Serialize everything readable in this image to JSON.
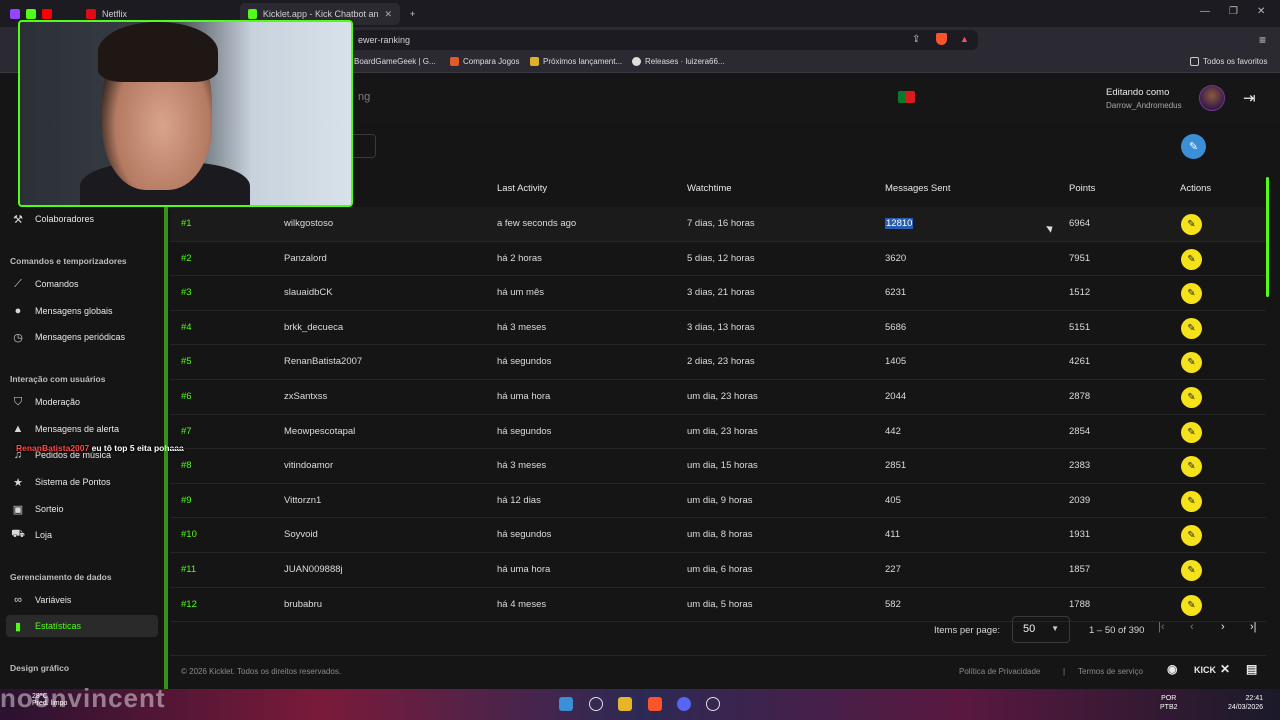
{
  "browser": {
    "tabs": [
      {
        "label": "Netflix"
      },
      {
        "label": "Kicklet.app - Kick Chatbot and C"
      }
    ],
    "new_tab": "+",
    "url": "ewer-ranking",
    "bookmarks": [
      {
        "label": "BoardGameGeek | G..."
      },
      {
        "label": "Compara Jogos"
      },
      {
        "label": "Próximos lançament..."
      },
      {
        "label": "Releases · luizera66..."
      },
      {
        "label": "Todos os favoritos"
      }
    ]
  },
  "header": {
    "page_title": "ng",
    "editing_label": "Editando como",
    "editing_user": "Darrow_Andromedus"
  },
  "sidebar": {
    "items_top": [
      {
        "label": "Colaboradores",
        "icon": "wrench-icon"
      }
    ],
    "sections": [
      {
        "heading": "Comandos e temporizadores",
        "items": [
          {
            "label": "Comandos",
            "icon": "wand-icon"
          },
          {
            "label": "Mensagens globais",
            "icon": "chat-icon"
          },
          {
            "label": "Mensagens periódicas",
            "icon": "clock-icon"
          }
        ]
      },
      {
        "heading": "Interação com usuários",
        "items": [
          {
            "label": "Moderação",
            "icon": "shield-icon"
          },
          {
            "label": "Mensagens de alerta",
            "icon": "alert-icon"
          },
          {
            "label": "Pedidos de música",
            "icon": "music-icon"
          },
          {
            "label": "Sistema de Pontos",
            "icon": "star-icon"
          },
          {
            "label": "Sorteio",
            "icon": "gift-icon"
          },
          {
            "label": "Loja",
            "icon": "cart-icon"
          }
        ]
      },
      {
        "heading": "Gerenciamento de dados",
        "items": [
          {
            "label": "Variáveis",
            "icon": "link-icon"
          },
          {
            "label": "Estatísticas",
            "icon": "bar-chart-icon",
            "active": true
          }
        ]
      },
      {
        "heading": "Design gráfico",
        "items": []
      }
    ]
  },
  "chat_overlay": {
    "user": "RenanBatista2007",
    "message": "eu tô top 5 eita pohaaa"
  },
  "table": {
    "headers": [
      "Last Activity",
      "Watchtime",
      "Messages Sent",
      "Points",
      "Actions"
    ],
    "rows": [
      {
        "rank": "#1",
        "user": "wilkgostoso",
        "activity": "a few seconds ago",
        "watchtime": "7 dias, 16 horas",
        "messages": "12810",
        "points": "6964"
      },
      {
        "rank": "#2",
        "user": "Panzalord",
        "activity": "há 2 horas",
        "watchtime": "5 dias, 12 horas",
        "messages": "3620",
        "points": "7951"
      },
      {
        "rank": "#3",
        "user": "slauaidbCK",
        "activity": "há um mês",
        "watchtime": "3 dias, 21 horas",
        "messages": "6231",
        "points": "1512"
      },
      {
        "rank": "#4",
        "user": "brkk_decueca",
        "activity": "há 3 meses",
        "watchtime": "3 dias, 13 horas",
        "messages": "5686",
        "points": "5151"
      },
      {
        "rank": "#5",
        "user": "RenanBatista2007",
        "activity": "há segundos",
        "watchtime": "2 dias, 23 horas",
        "messages": "1405",
        "points": "4261"
      },
      {
        "rank": "#6",
        "user": "zxSantxss",
        "activity": "há uma hora",
        "watchtime": "um dia, 23 horas",
        "messages": "2044",
        "points": "2878"
      },
      {
        "rank": "#7",
        "user": "Meowpescotapal",
        "activity": "há segundos",
        "watchtime": "um dia, 23 horas",
        "messages": "442",
        "points": "2854"
      },
      {
        "rank": "#8",
        "user": "vitindoamor",
        "activity": "há 3 meses",
        "watchtime": "um dia, 15 horas",
        "messages": "2851",
        "points": "2383"
      },
      {
        "rank": "#9",
        "user": "Vittorzn1",
        "activity": "há 12 dias",
        "watchtime": "um dia, 9 horas",
        "messages": "405",
        "points": "2039"
      },
      {
        "rank": "#10",
        "user": "Soyvoid",
        "activity": "há segundos",
        "watchtime": "um dia, 8 horas",
        "messages": "411",
        "points": "1931"
      },
      {
        "rank": "#11",
        "user": "JUAN009888j",
        "activity": "há uma hora",
        "watchtime": "um dia, 6 horas",
        "messages": "227",
        "points": "1857"
      },
      {
        "rank": "#12",
        "user": "brubabru",
        "activity": "há 4 meses",
        "watchtime": "um dia, 5 horas",
        "messages": "582",
        "points": "1788"
      }
    ]
  },
  "paginator": {
    "label": "Items per page:",
    "page_size": "50",
    "range": "1 – 50 of 390"
  },
  "footer": {
    "copyright": "© 2026 Kicklet. Todos os direitos reservados.",
    "privacy": "Política de Privacidade",
    "separator": "|",
    "terms": "Termos de serviço",
    "kick": "KICK"
  },
  "taskbar": {
    "weather": "28°C",
    "weather_desc": "Pred. limpo",
    "watermark": "noonvincent",
    "lang": "POR",
    "lang2": "PTB2",
    "time": "22:41",
    "date": "24/03/2026"
  },
  "colors": {
    "accent": "#53fc18",
    "edit_button": "#f6e21a",
    "selection": "#2a5db0"
  }
}
